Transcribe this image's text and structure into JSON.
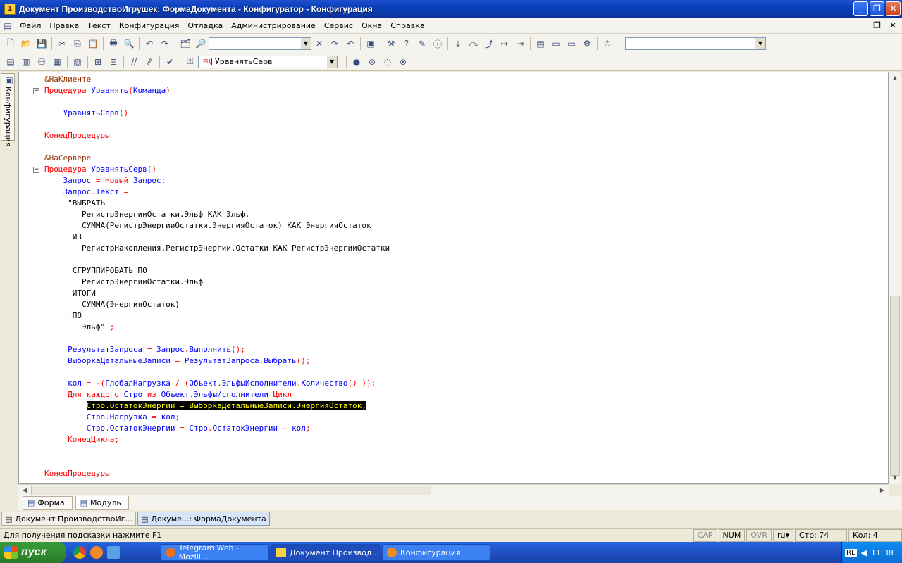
{
  "window": {
    "title": "Документ ПроизводствоИгрушек: ФормаДокумента - Конфигуратор - Конфигурация",
    "minimize": "_",
    "restore": "❐",
    "close": "✕"
  },
  "menu": {
    "items": [
      "Файл",
      "Правка",
      "Текст",
      "Конфигурация",
      "Отладка",
      "Администрирование",
      "Сервис",
      "Окна",
      "Справка"
    ],
    "ctrl_min": "_",
    "ctrl_restore": "❐",
    "ctrl_close": "✕"
  },
  "toolbar2": {
    "procedure_combo_value": "УравнятьСерв",
    "procedure_combo_badge": "PЦ"
  },
  "sidetab": {
    "label": "Конфигурация"
  },
  "editor": {
    "lines": [
      {
        "text": "&НаКлиенте",
        "cls": "pre"
      },
      {
        "parts": [
          [
            "Процедура ",
            "kw"
          ],
          [
            "Уравнять",
            "id"
          ],
          [
            "(",
            "kw"
          ],
          [
            "Команда",
            "id"
          ],
          [
            ")",
            "kw"
          ]
        ]
      },
      {
        "text": ""
      },
      {
        "parts": [
          [
            "    ",
            ""
          ],
          [
            "УравнятьСерв",
            "id"
          ],
          [
            "()",
            "kw"
          ]
        ]
      },
      {
        "text": ""
      },
      {
        "text": "КонецПроцедуры",
        "cls": "kw"
      },
      {
        "text": ""
      },
      {
        "text": "&НаСервере",
        "cls": "pre"
      },
      {
        "parts": [
          [
            "Процедура ",
            "kw"
          ],
          [
            "УравнятьСерв",
            "id"
          ],
          [
            "()",
            "kw"
          ]
        ]
      },
      {
        "parts": [
          [
            "    ",
            ""
          ],
          [
            "Запрос",
            "id"
          ],
          [
            " = ",
            "kw"
          ],
          [
            "Новый ",
            "kw"
          ],
          [
            "Запрос",
            "id"
          ],
          [
            ";",
            "kw"
          ]
        ]
      },
      {
        "parts": [
          [
            "    ",
            ""
          ],
          [
            "Запрос",
            "id"
          ],
          [
            ".",
            "kw"
          ],
          [
            "Текст",
            "id"
          ],
          [
            " =",
            "kw"
          ]
        ]
      },
      {
        "text": "     \"ВЫБРАТЬ",
        "cls": "str"
      },
      {
        "text": "     |  РегистрЭнергииОстатки.Эльф КАК Эльф,",
        "cls": "str"
      },
      {
        "text": "     |  СУММА(РегистрЭнергииОстатки.ЭнергияОстаток) КАК ЭнергияОстаток",
        "cls": "str"
      },
      {
        "text": "     |ИЗ",
        "cls": "str"
      },
      {
        "text": "     |  РегистрНакопления.РегистрЭнергии.Остатки КАК РегистрЭнергииОстатки",
        "cls": "str"
      },
      {
        "text": "     |",
        "cls": "str"
      },
      {
        "text": "     |СГРУППИРОВАТЬ ПО",
        "cls": "str"
      },
      {
        "text": "     |  РегистрЭнергииОстатки.Эльф",
        "cls": "str"
      },
      {
        "text": "     |ИТОГИ",
        "cls": "str"
      },
      {
        "text": "     |  СУММА(ЭнергияОстаток)",
        "cls": "str"
      },
      {
        "text": "     |ПО",
        "cls": "str"
      },
      {
        "parts": [
          [
            "     |  Эльф\"",
            ""
          ],
          [
            " ;",
            "kw"
          ]
        ]
      },
      {
        "text": ""
      },
      {
        "parts": [
          [
            "     ",
            ""
          ],
          [
            "РезультатЗапроса",
            "id"
          ],
          [
            " = ",
            "kw"
          ],
          [
            "Запрос",
            "id"
          ],
          [
            ".",
            "kw"
          ],
          [
            "Выполнить",
            "id"
          ],
          [
            "();",
            "kw"
          ]
        ]
      },
      {
        "parts": [
          [
            "     ",
            ""
          ],
          [
            "ВыборкаДетальныеЗаписи",
            "id"
          ],
          [
            " = ",
            "kw"
          ],
          [
            "РезультатЗапроса",
            "id"
          ],
          [
            ".",
            "kw"
          ],
          [
            "Выбрать",
            "id"
          ],
          [
            "();",
            "kw"
          ]
        ]
      },
      {
        "text": ""
      },
      {
        "parts": [
          [
            "     ",
            ""
          ],
          [
            "кол",
            "id"
          ],
          [
            " = -(",
            "kw"
          ],
          [
            "ГлобалНагрузка",
            "id"
          ],
          [
            " / (",
            "kw"
          ],
          [
            "Объект",
            "id"
          ],
          [
            ".",
            "kw"
          ],
          [
            "ЭльфыИсполнители",
            "id"
          ],
          [
            ".",
            "kw"
          ],
          [
            "Количество",
            "id"
          ],
          [
            "() ));",
            "kw"
          ]
        ]
      },
      {
        "parts": [
          [
            "     ",
            ""
          ],
          [
            "Для каждого ",
            "kw"
          ],
          [
            "Стро",
            "id"
          ],
          [
            " из ",
            "kw"
          ],
          [
            "Объект",
            "id"
          ],
          [
            ".",
            "kw"
          ],
          [
            "ЭльфыИсполнители",
            "id"
          ],
          [
            " Цикл",
            "kw"
          ]
        ]
      },
      {
        "parts": [
          [
            "         ",
            ""
          ],
          [
            "Стро.ОстатокЭнергии = ВыборкаДетальныеЗаписи.ЭнергияОстаток;",
            "hl"
          ]
        ]
      },
      {
        "parts": [
          [
            "         ",
            ""
          ],
          [
            "Стро",
            "id"
          ],
          [
            ".",
            "kw"
          ],
          [
            "Нагрузка",
            "id"
          ],
          [
            " = ",
            "kw"
          ],
          [
            "кол",
            "id"
          ],
          [
            ";",
            "kw"
          ]
        ]
      },
      {
        "parts": [
          [
            "         ",
            ""
          ],
          [
            "Стро",
            "id"
          ],
          [
            ".",
            "kw"
          ],
          [
            "ОстатокЭнергии",
            "id"
          ],
          [
            " = ",
            "kw"
          ],
          [
            "Стро",
            "id"
          ],
          [
            ".",
            "kw"
          ],
          [
            "ОстатокЭнергии",
            "id"
          ],
          [
            " - ",
            "kw"
          ],
          [
            "кол",
            "id"
          ],
          [
            ";",
            "kw"
          ]
        ]
      },
      {
        "parts": [
          [
            "     ",
            ""
          ],
          [
            "КонецЦикла",
            "kw"
          ],
          [
            ";",
            "kw"
          ]
        ]
      },
      {
        "text": ""
      },
      {
        "text": ""
      },
      {
        "text": "КонецПроцедуры",
        "cls": "kw"
      }
    ]
  },
  "bottom_tabs": [
    "Форма",
    "Модуль"
  ],
  "window_tabs": [
    "Документ ПроизводствоИг...",
    "Докуме...: ФормаДокумента"
  ],
  "status": {
    "hint": "Для получения подсказки нажмите F1",
    "cap": "CAP",
    "num": "NUM",
    "ovr": "OVR",
    "lang": "ru",
    "line": "Стр: 74",
    "col": "Кол: 4"
  },
  "taskbar": {
    "start": "пуск",
    "tasks": [
      "Telegram Web - Mozill...",
      "Документ Производ...",
      "Конфигурация"
    ],
    "lang": "RL",
    "clock": "11:38"
  }
}
